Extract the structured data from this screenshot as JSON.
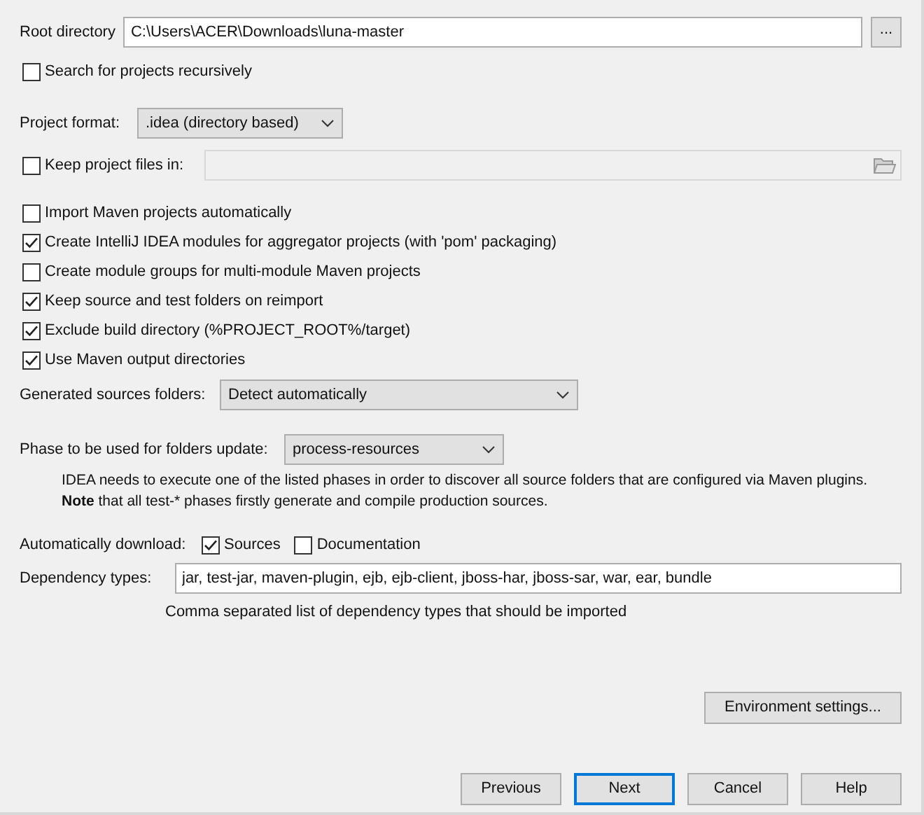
{
  "root_directory": {
    "label": "Root directory",
    "value": "C:\\Users\\ACER\\Downloads\\luna-master",
    "browse": "..."
  },
  "search_recursively": {
    "label": "Search for projects recursively",
    "checked": false
  },
  "project_format": {
    "label": "Project format:",
    "value": ".idea (directory based)"
  },
  "keep_project_files": {
    "label": "Keep project files in:",
    "checked": false,
    "disabled": true
  },
  "options": [
    {
      "label": "Import Maven projects automatically",
      "checked": false
    },
    {
      "label": "Create IntelliJ IDEA modules for aggregator projects (with 'pom' packaging)",
      "checked": true
    },
    {
      "label": "Create module groups for multi-module Maven projects",
      "checked": false
    },
    {
      "label": "Keep source and test folders on reimport",
      "checked": true
    },
    {
      "label": "Exclude build directory (%PROJECT_ROOT%/target)",
      "checked": true
    },
    {
      "label": "Use Maven output directories",
      "checked": true
    }
  ],
  "generated_sources": {
    "label": "Generated sources folders:",
    "value": "Detect automatically"
  },
  "phase": {
    "label": "Phase to be used for folders update:",
    "value": "process-resources",
    "note": [
      "IDEA needs to execute one of the listed phases in order to discover all source folders that are configured via Maven plugins.",
      "**Note** that all test-* phases firstly generate and compile production sources."
    ]
  },
  "automatically_download": {
    "label": "Automatically download:",
    "items": [
      {
        "label": "Sources",
        "checked": true
      },
      {
        "label": "Documentation",
        "checked": false
      }
    ]
  },
  "dependency_types": {
    "label": "Dependency types:",
    "value": "jar, test-jar, maven-plugin, ejb, ejb-client, jboss-har, jboss-sar, war, ear, bundle",
    "hint": "Comma separated list of dependency types that should be imported"
  },
  "environment_button": "Environment settings...",
  "buttons": [
    {
      "label": "Previous",
      "default": false
    },
    {
      "label": "Next",
      "default": true
    },
    {
      "label": "Cancel",
      "default": false
    },
    {
      "label": "Help",
      "default": false
    }
  ]
}
